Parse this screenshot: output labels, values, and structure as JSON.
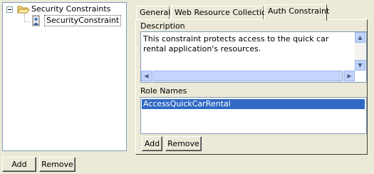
{
  "tree": {
    "root_label": "Security Constraints",
    "child_label": "SecurityConstraint"
  },
  "left_buttons": {
    "add": "Add",
    "remove": "Remove"
  },
  "tabs": [
    {
      "label": "General"
    },
    {
      "label": "Web Resource Collection"
    },
    {
      "label": "Auth Constraint",
      "active": true
    }
  ],
  "description": {
    "label": "Description",
    "text": "This constraint protects access to the quick car rental application's resources."
  },
  "roles": {
    "label": "Role Names",
    "items": [
      "AccessQuickCarRental"
    ]
  },
  "role_buttons": {
    "add": "Add",
    "remove": "Remove"
  },
  "icons": {
    "root": "folder-open-icon",
    "child": "security-constraint-icon"
  },
  "colors": {
    "selection": "#316ac5",
    "panel": "#ece9d8"
  }
}
